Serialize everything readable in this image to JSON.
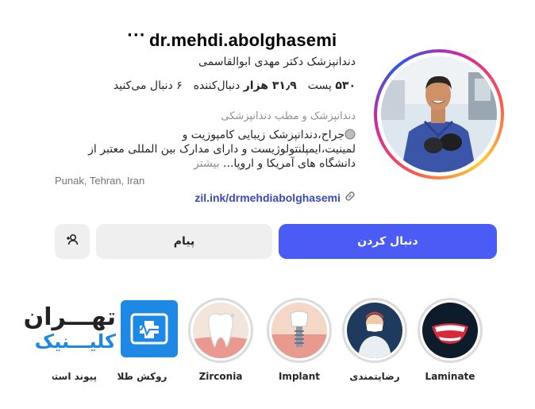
{
  "profile": {
    "username": "dr.mehdi.abolghasemi",
    "more_icon": "ellipsis-icon",
    "full_name": "دندانپزشک دکتر مهدی ابوالقاسمی",
    "stats": {
      "posts_value": "۵۳۰",
      "posts_label": "پست",
      "followers_value": "۳۱٫۹ هزار",
      "followers_label": "دنبال‌کننده",
      "following_value": "۶",
      "following_label": "دنبال می‌کنید"
    },
    "category": "دندانپزشک و مطب دندانپزشکی",
    "bio_line1": "جراح،دندانپزشک زیبایی کامپوزیت و",
    "bio_line2": "لمینیت،ایمپلنتولوژیست و دارای مدارک بین المللی معتبر از",
    "bio_line3": "دانشگاه های آمریکا و اروپا...",
    "bio_more": "بیشتر",
    "location": "Punak, Tehran, Iran",
    "link": "zil.ink/drmehdiabolghasemi"
  },
  "actions": {
    "follow_label": "دنبال کردن",
    "message_label": "پیام"
  },
  "highlights": [
    {
      "label": "Laminate",
      "icon": "smile-teeth-icon"
    },
    {
      "label": "رضایتمندی",
      "icon": "dentist-mask-icon"
    },
    {
      "label": "Implant",
      "icon": "implant-icon"
    },
    {
      "label": "Zirconia",
      "icon": "tooth-icon"
    },
    {
      "label": "روکش طلا",
      "icon": "medical-cross-icon"
    },
    {
      "label": "پیوند استخوان",
      "text_line1": "تهـــران",
      "text_line2": "کلیـــنیک"
    }
  ],
  "colors": {
    "primary": "#4a5cf5",
    "secondary_bg": "#efefef",
    "link": "#3a48b8"
  }
}
